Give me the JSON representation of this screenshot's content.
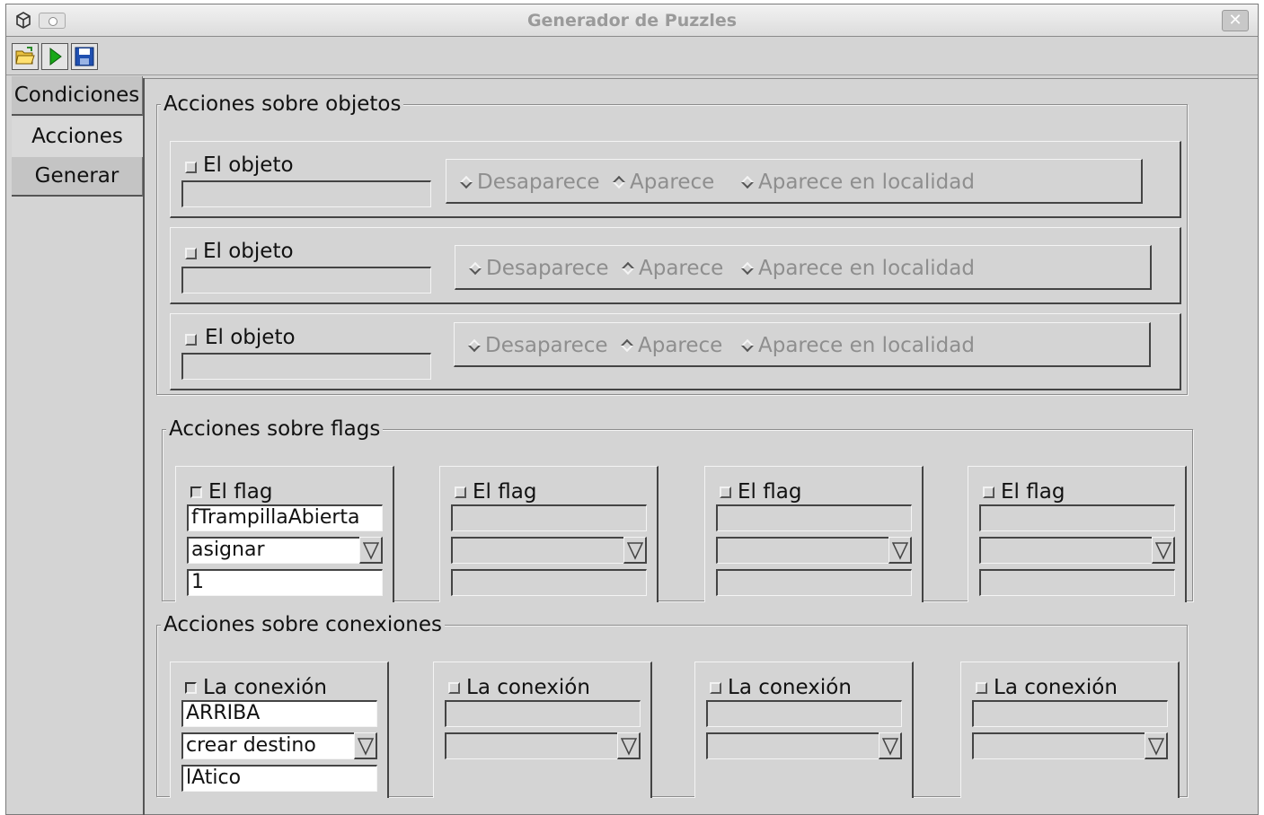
{
  "window": {
    "title": "Generador de Puzzles",
    "close_glyph": "✕"
  },
  "toolbar": {
    "tools": [
      {
        "icon": "open-folder-icon"
      },
      {
        "icon": "run-icon"
      },
      {
        "icon": "save-icon"
      }
    ]
  },
  "tabs": [
    {
      "label": "Condiciones",
      "active": false
    },
    {
      "label": "Acciones",
      "active": true
    },
    {
      "label": "Generar",
      "active": false
    }
  ],
  "objetos": {
    "title": "Acciones sobre objetos",
    "rows": [
      {
        "label": "El objeto",
        "checked": false,
        "value": "",
        "options": [
          "Desaparece",
          "Aparece",
          "Aparece en localidad"
        ]
      },
      {
        "label": "El objeto",
        "checked": false,
        "value": "",
        "options": [
          "Desaparece",
          "Aparece",
          "Aparece en localidad"
        ]
      },
      {
        "label": "El objeto",
        "checked": false,
        "value": "",
        "options": [
          "Desaparece",
          "Aparece",
          "Aparece en localidad"
        ]
      }
    ]
  },
  "flags": {
    "title": "Acciones sobre flags",
    "items": [
      {
        "label": "El flag",
        "checked": true,
        "name": "fTrampillaAbierta",
        "op": "asignar",
        "value": "1"
      },
      {
        "label": "El flag",
        "checked": false,
        "name": "",
        "op": "",
        "value": ""
      },
      {
        "label": "El flag",
        "checked": false,
        "name": "",
        "op": "",
        "value": ""
      },
      {
        "label": "El flag",
        "checked": false,
        "name": "",
        "op": "",
        "value": ""
      }
    ]
  },
  "conexiones": {
    "title": "Acciones sobre conexiones",
    "items": [
      {
        "label": "La conexión",
        "checked": true,
        "dir": "ARRIBA",
        "op": "crear destino",
        "dest": "lAtico"
      },
      {
        "label": "La conexión",
        "checked": false,
        "dir": "",
        "op": "",
        "dest": ""
      },
      {
        "label": "La conexión",
        "checked": false,
        "dir": "",
        "op": "",
        "dest": ""
      },
      {
        "label": "La conexión",
        "checked": false,
        "dir": "",
        "op": "",
        "dest": ""
      }
    ]
  }
}
